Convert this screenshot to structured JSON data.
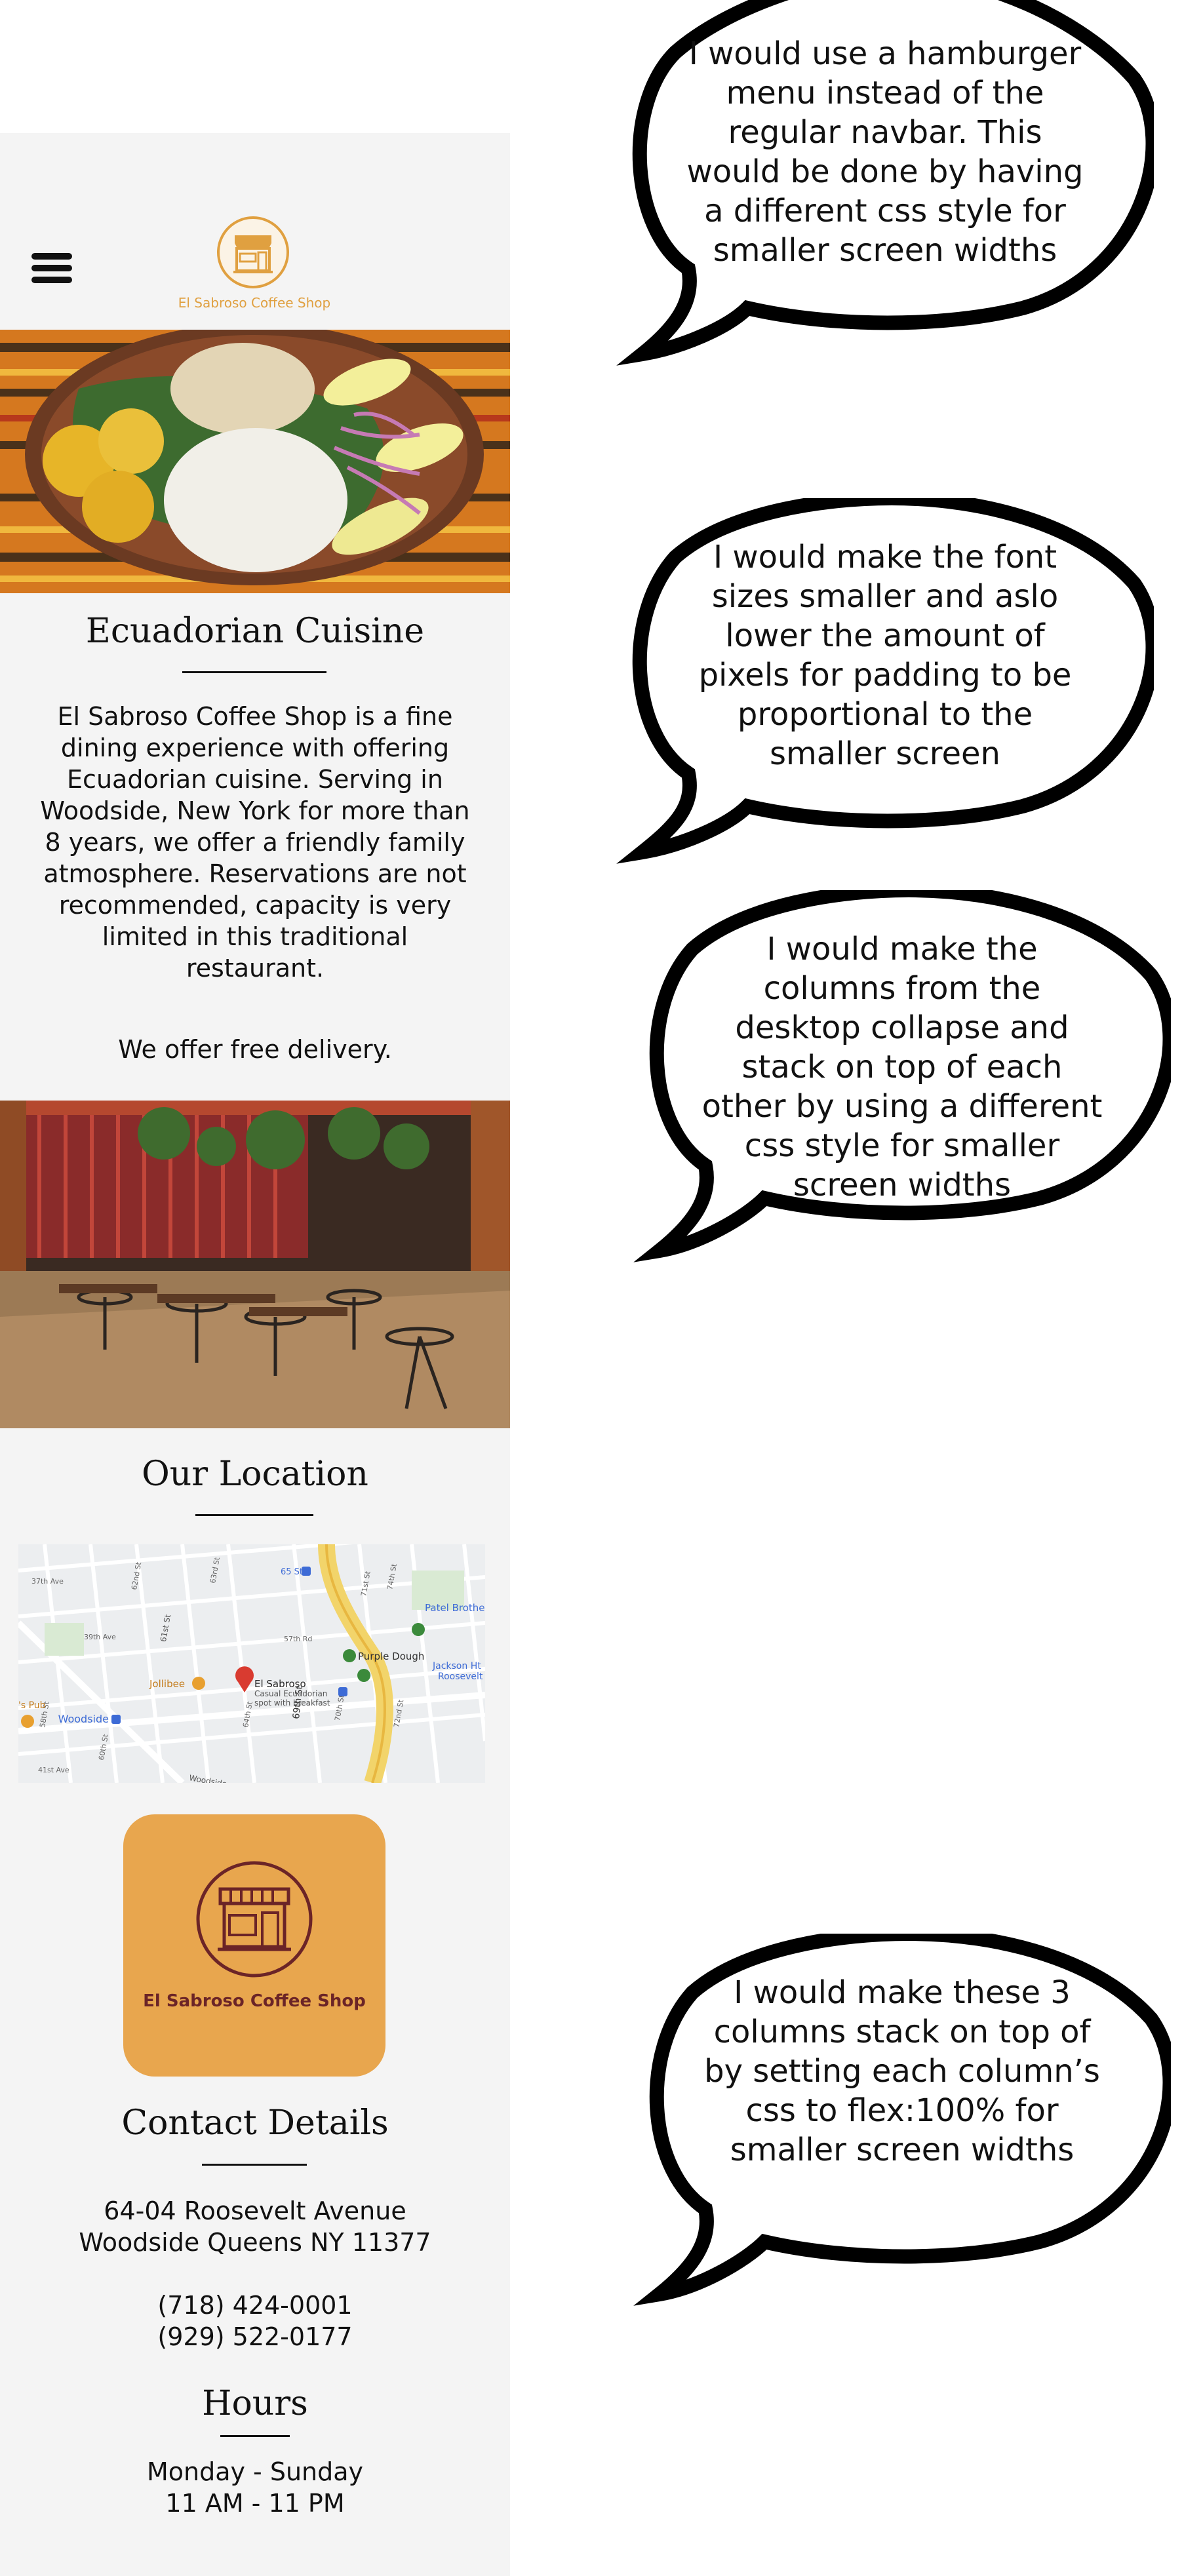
{
  "site": {
    "brand_name": "El Sabroso Coffee Shop",
    "brand_small_label": "El Sabroso Coffee Shop"
  },
  "about": {
    "heading": "Ecuadorian Cuisine",
    "lines": [
      "El Sabroso Coffee Shop is a fine",
      "dining experience with offering",
      "Ecuadorian cuisine. Serving in",
      "Woodside, New York for more than",
      "8 years, we offer a friendly  family",
      "atmosphere. Reservations are not",
      "recommended, capacity is very",
      "limited in this traditional",
      "restaurant."
    ],
    "delivery": "We offer free delivery."
  },
  "location": {
    "heading": "Our Location",
    "map_labels": {
      "pin_name": "El Sabroso",
      "pin_desc_1": "Casual Ecuadorian",
      "pin_desc_2": "spot with breakfast",
      "jollibee": "Jollibee",
      "purple_dough": "Purple Dough",
      "patel": "Patel Brothers",
      "jackson": "Jackson Ht",
      "roosevelt": "Roosevelt",
      "woodside": "Woodside",
      "pub": "'s Pub",
      "st65": "65 St",
      "st61": "61st St",
      "ave39": "39th Ave",
      "ave37": "37th Ave",
      "ave41": "41st Ave",
      "st64": "64th St",
      "st69": "69th St",
      "st58": "58th St",
      "st72": "72nd St",
      "st71": "71st St",
      "st70": "70th St",
      "st74": "74th St",
      "rd57": "57th Rd",
      "st62": "62nd St",
      "st63": "63rd St",
      "st60": "60th St",
      "woodside_st": "Woodside"
    }
  },
  "contact": {
    "heading": "Contact Details",
    "address_1": "64-04 Roosevelt Avenue",
    "address_2": "Woodside Queens NY 11377",
    "phone_1": "(718) 424-0001",
    "phone_2": "(929) 522-0177"
  },
  "hours": {
    "heading": "Hours",
    "days": "Monday - Sunday",
    "time": "11 AM - 11 PM"
  },
  "annotations": [
    {
      "lines": [
        "I would use a hamburger",
        "menu instead of the",
        "regular navbar. This",
        "would be done by having",
        "a different css style for",
        "smaller screen widths"
      ]
    },
    {
      "lines": [
        "I would make the font",
        "sizes smaller and aslo",
        "lower the amount of",
        "pixels for padding to be",
        "proportional to the",
        "smaller screen"
      ]
    },
    {
      "lines": [
        "I would make the",
        "columns from the",
        "desktop collapse and",
        "stack on top of each",
        "other by using a different",
        "css style for smaller",
        "screen widths"
      ]
    },
    {
      "lines": [
        "I would make these 3",
        "columns stack on top of",
        "by setting each column’s",
        "css to flex:100% for",
        "smaller screen widths"
      ]
    }
  ],
  "colors": {
    "page_bg": "#f4f4f4",
    "logo_orange": "#e8a64e",
    "logo_maroon": "#6b2427",
    "small_logo_orange": "#e0a040"
  }
}
